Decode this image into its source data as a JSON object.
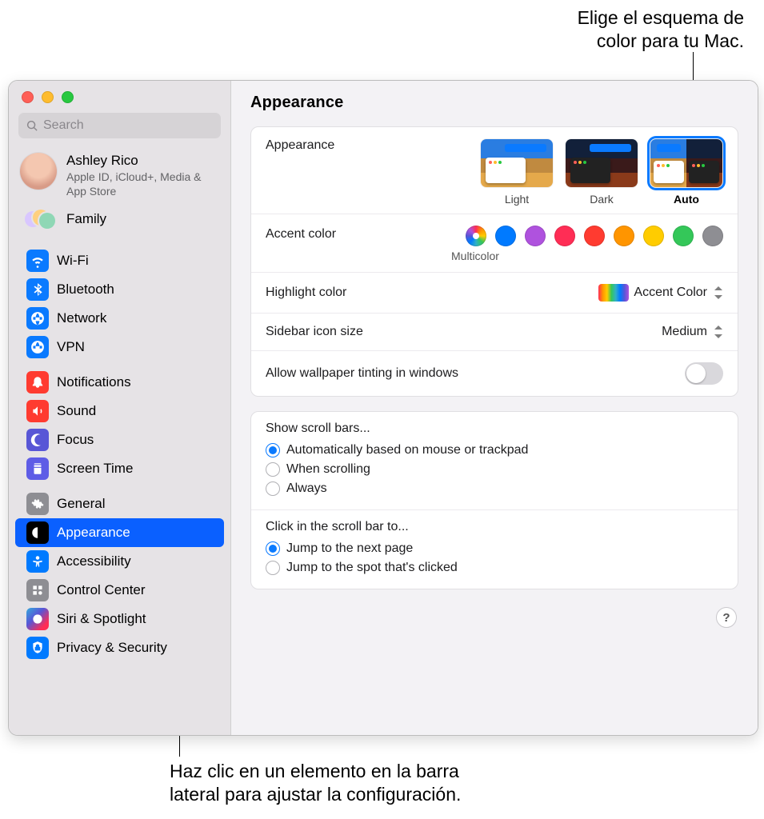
{
  "callouts": {
    "top": "Elige el esquema de\ncolor para tu Mac.",
    "bottom": "Haz clic en un elemento en la barra\nlateral para ajustar la configuración."
  },
  "search": {
    "placeholder": "Search"
  },
  "account": {
    "name": "Ashley Rico",
    "sub": "Apple ID, iCloud+, Media & App Store"
  },
  "family_label": "Family",
  "sidebar_groups": [
    [
      {
        "key": "wifi",
        "label": "Wi-Fi"
      },
      {
        "key": "bluetooth",
        "label": "Bluetooth"
      },
      {
        "key": "network",
        "label": "Network"
      },
      {
        "key": "vpn",
        "label": "VPN"
      }
    ],
    [
      {
        "key": "notifications",
        "label": "Notifications"
      },
      {
        "key": "sound",
        "label": "Sound"
      },
      {
        "key": "focus",
        "label": "Focus"
      },
      {
        "key": "screentime",
        "label": "Screen Time"
      }
    ],
    [
      {
        "key": "general",
        "label": "General"
      },
      {
        "key": "appearance",
        "label": "Appearance"
      },
      {
        "key": "accessibility",
        "label": "Accessibility"
      },
      {
        "key": "controlcenter",
        "label": "Control Center"
      },
      {
        "key": "siri",
        "label": "Siri & Spotlight"
      },
      {
        "key": "privacy",
        "label": "Privacy & Security"
      }
    ]
  ],
  "main": {
    "title": "Appearance",
    "appearance_label": "Appearance",
    "appearance_options": [
      "Light",
      "Dark",
      "Auto"
    ],
    "appearance_selected": "Auto",
    "accent_label": "Accent color",
    "accent_caption": "Multicolor",
    "accent_colors": [
      {
        "name": "Multicolor",
        "hex": "multi",
        "selected": true
      },
      {
        "name": "Blue",
        "hex": "#007aff"
      },
      {
        "name": "Purple",
        "hex": "#af52de"
      },
      {
        "name": "Pink",
        "hex": "#ff2d55"
      },
      {
        "name": "Red",
        "hex": "#ff3b30"
      },
      {
        "name": "Orange",
        "hex": "#ff9500"
      },
      {
        "name": "Yellow",
        "hex": "#ffcc00"
      },
      {
        "name": "Green",
        "hex": "#34c759"
      },
      {
        "name": "Graphite",
        "hex": "#8e8e93"
      }
    ],
    "highlight_label": "Highlight color",
    "highlight_value": "Accent Color",
    "sidebar_size_label": "Sidebar icon size",
    "sidebar_size_value": "Medium",
    "tinting_label": "Allow wallpaper tinting in windows",
    "tinting_on": false,
    "scrollbars": {
      "title": "Show scroll bars...",
      "options": [
        "Automatically based on mouse or trackpad",
        "When scrolling",
        "Always"
      ],
      "selected": 0
    },
    "scrollclick": {
      "title": "Click in the scroll bar to...",
      "options": [
        "Jump to the next page",
        "Jump to the spot that's clicked"
      ],
      "selected": 0
    },
    "help": "?"
  },
  "icons": {
    "wifi": "blue",
    "bluetooth": "blue",
    "network": "blue",
    "vpn": "blue",
    "notifications": "red",
    "sound": "red",
    "focus": "purple",
    "screentime": "indigo",
    "general": "gray",
    "appearance": "black",
    "accessibility": "teal",
    "controlcenter": "gray",
    "siri": "siri",
    "privacy": "teal"
  },
  "active_sidebar": "appearance"
}
